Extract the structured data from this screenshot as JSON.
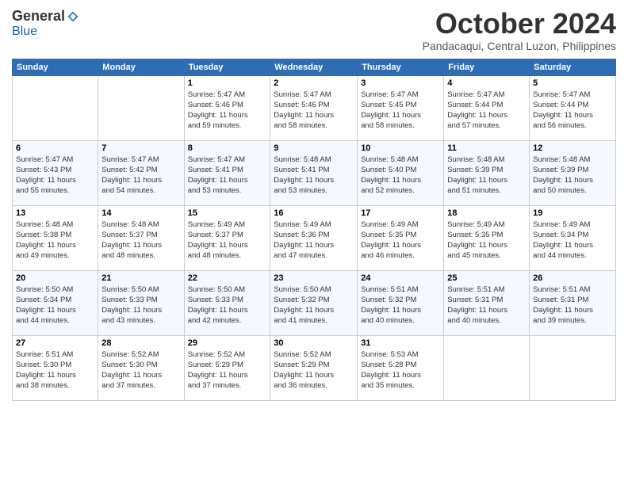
{
  "logo": {
    "general": "General",
    "blue": "Blue"
  },
  "title": "October 2024",
  "location": "Pandacaqui, Central Luzon, Philippines",
  "days_of_week": [
    "Sunday",
    "Monday",
    "Tuesday",
    "Wednesday",
    "Thursday",
    "Friday",
    "Saturday"
  ],
  "weeks": [
    [
      {
        "day": "",
        "info": ""
      },
      {
        "day": "",
        "info": ""
      },
      {
        "day": "1",
        "info": "Sunrise: 5:47 AM\nSunset: 5:46 PM\nDaylight: 11 hours\nand 59 minutes."
      },
      {
        "day": "2",
        "info": "Sunrise: 5:47 AM\nSunset: 5:46 PM\nDaylight: 11 hours\nand 58 minutes."
      },
      {
        "day": "3",
        "info": "Sunrise: 5:47 AM\nSunset: 5:45 PM\nDaylight: 11 hours\nand 58 minutes."
      },
      {
        "day": "4",
        "info": "Sunrise: 5:47 AM\nSunset: 5:44 PM\nDaylight: 11 hours\nand 57 minutes."
      },
      {
        "day": "5",
        "info": "Sunrise: 5:47 AM\nSunset: 5:44 PM\nDaylight: 11 hours\nand 56 minutes."
      }
    ],
    [
      {
        "day": "6",
        "info": "Sunrise: 5:47 AM\nSunset: 5:43 PM\nDaylight: 11 hours\nand 55 minutes."
      },
      {
        "day": "7",
        "info": "Sunrise: 5:47 AM\nSunset: 5:42 PM\nDaylight: 11 hours\nand 54 minutes."
      },
      {
        "day": "8",
        "info": "Sunrise: 5:47 AM\nSunset: 5:41 PM\nDaylight: 11 hours\nand 53 minutes."
      },
      {
        "day": "9",
        "info": "Sunrise: 5:48 AM\nSunset: 5:41 PM\nDaylight: 11 hours\nand 53 minutes."
      },
      {
        "day": "10",
        "info": "Sunrise: 5:48 AM\nSunset: 5:40 PM\nDaylight: 11 hours\nand 52 minutes."
      },
      {
        "day": "11",
        "info": "Sunrise: 5:48 AM\nSunset: 5:39 PM\nDaylight: 11 hours\nand 51 minutes."
      },
      {
        "day": "12",
        "info": "Sunrise: 5:48 AM\nSunset: 5:39 PM\nDaylight: 11 hours\nand 50 minutes."
      }
    ],
    [
      {
        "day": "13",
        "info": "Sunrise: 5:48 AM\nSunset: 5:38 PM\nDaylight: 11 hours\nand 49 minutes."
      },
      {
        "day": "14",
        "info": "Sunrise: 5:48 AM\nSunset: 5:37 PM\nDaylight: 11 hours\nand 48 minutes."
      },
      {
        "day": "15",
        "info": "Sunrise: 5:49 AM\nSunset: 5:37 PM\nDaylight: 11 hours\nand 48 minutes."
      },
      {
        "day": "16",
        "info": "Sunrise: 5:49 AM\nSunset: 5:36 PM\nDaylight: 11 hours\nand 47 minutes."
      },
      {
        "day": "17",
        "info": "Sunrise: 5:49 AM\nSunset: 5:35 PM\nDaylight: 11 hours\nand 46 minutes."
      },
      {
        "day": "18",
        "info": "Sunrise: 5:49 AM\nSunset: 5:35 PM\nDaylight: 11 hours\nand 45 minutes."
      },
      {
        "day": "19",
        "info": "Sunrise: 5:49 AM\nSunset: 5:34 PM\nDaylight: 11 hours\nand 44 minutes."
      }
    ],
    [
      {
        "day": "20",
        "info": "Sunrise: 5:50 AM\nSunset: 5:34 PM\nDaylight: 11 hours\nand 44 minutes."
      },
      {
        "day": "21",
        "info": "Sunrise: 5:50 AM\nSunset: 5:33 PM\nDaylight: 11 hours\nand 43 minutes."
      },
      {
        "day": "22",
        "info": "Sunrise: 5:50 AM\nSunset: 5:33 PM\nDaylight: 11 hours\nand 42 minutes."
      },
      {
        "day": "23",
        "info": "Sunrise: 5:50 AM\nSunset: 5:32 PM\nDaylight: 11 hours\nand 41 minutes."
      },
      {
        "day": "24",
        "info": "Sunrise: 5:51 AM\nSunset: 5:32 PM\nDaylight: 11 hours\nand 40 minutes."
      },
      {
        "day": "25",
        "info": "Sunrise: 5:51 AM\nSunset: 5:31 PM\nDaylight: 11 hours\nand 40 minutes."
      },
      {
        "day": "26",
        "info": "Sunrise: 5:51 AM\nSunset: 5:31 PM\nDaylight: 11 hours\nand 39 minutes."
      }
    ],
    [
      {
        "day": "27",
        "info": "Sunrise: 5:51 AM\nSunset: 5:30 PM\nDaylight: 11 hours\nand 38 minutes."
      },
      {
        "day": "28",
        "info": "Sunrise: 5:52 AM\nSunset: 5:30 PM\nDaylight: 11 hours\nand 37 minutes."
      },
      {
        "day": "29",
        "info": "Sunrise: 5:52 AM\nSunset: 5:29 PM\nDaylight: 11 hours\nand 37 minutes."
      },
      {
        "day": "30",
        "info": "Sunrise: 5:52 AM\nSunset: 5:29 PM\nDaylight: 11 hours\nand 36 minutes."
      },
      {
        "day": "31",
        "info": "Sunrise: 5:53 AM\nSunset: 5:28 PM\nDaylight: 11 hours\nand 35 minutes."
      },
      {
        "day": "",
        "info": ""
      },
      {
        "day": "",
        "info": ""
      }
    ]
  ]
}
